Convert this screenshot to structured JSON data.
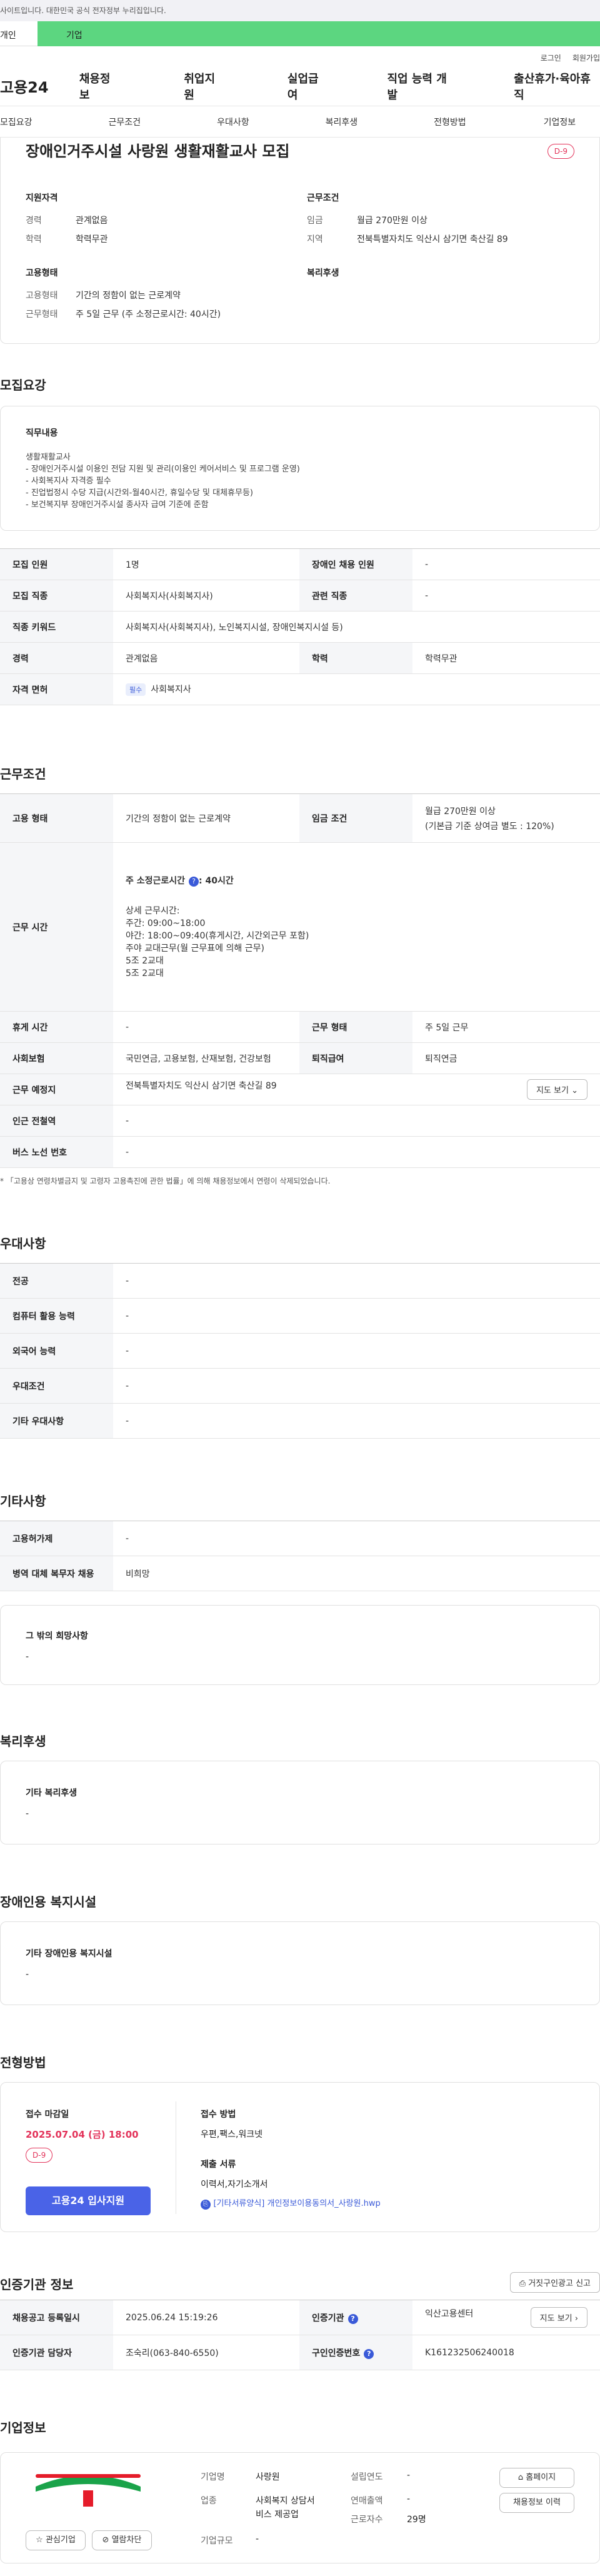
{
  "gov_notice": "사이트입니다. 대한민국 공식 전자정부 누리집입니다.",
  "tabs": {
    "person": "개인",
    "corp": "기업"
  },
  "util": {
    "login": "로그인",
    "join": "회원가입"
  },
  "logo": "고용24",
  "gnb": [
    "채용정보",
    "취업지원",
    "실업급여",
    "직업 능력 개발",
    "출산휴가·육아휴직"
  ],
  "subnav": [
    "모집요강",
    "근무조건",
    "우대사항",
    "복리후생",
    "전형방법",
    "기업정보"
  ],
  "job": {
    "title": "장애인거주시설 사랑원 생활재활교사 모집",
    "dday": "D-9"
  },
  "summary": {
    "qual_head": "지원자격",
    "career_label": "경력",
    "career": "관계없음",
    "edu_label": "학력",
    "edu": "학력무관",
    "cond_head": "근무조건",
    "wage_label": "임금",
    "wage": "월급 270만원 이상",
    "region_label": "지역",
    "region": "전북특별자치도 익산시 삼기면 축산길 89",
    "emp_head": "고용형태",
    "type_label": "고용형태",
    "type": "기간의 정함이 없는 근로계약",
    "shift_label": "근무형태",
    "shift": "주 5일 근무 (주 소정근로시간: 40시간)",
    "welfare_head": "복리후생"
  },
  "recruit": {
    "title": "모집요강",
    "duty_head": "직무내용",
    "duty_lines": [
      "생활재활교사",
      "- 장애인거주시설 이용인 전담 지원 및 관리(이용인 케어서비스 및 프로그램 운영)",
      "- 사회복지사 자격증 필수",
      "- 진업법정시 수당 지급(시간외-월40시간, 휴일수당 및 대체휴무등)",
      "- 보건복지부 장애인거주시설 종사자 급여 기준에 준함"
    ],
    "rows": [
      {
        "l1": "모집 인원",
        "v1": "1명",
        "l2": "장애인 채용 인원",
        "v2": "-"
      },
      {
        "l1": "모집 직종",
        "v1": "사회복지사(사회복지사)",
        "l2": "관련 직종",
        "v2": "-"
      }
    ],
    "keyword_label": "직종 키워드",
    "keyword": "사회복지사(사회복지사), 노인복지시설, 장애인복지시설 등)",
    "career_label": "경력",
    "career": "관계없음",
    "edu_label": "학력",
    "edu": "학력무관",
    "license_label": "자격 면허",
    "license_badge": "필수",
    "license": "사회복지사"
  },
  "work": {
    "title": "근무조건",
    "type_label": "고용 형태",
    "type": "기간의 정함이 없는 근로계약",
    "wage_label": "임금 조건",
    "wage1": "월급 270만원 이상",
    "wage2": "(기본급 기준 상여금 별도 : 120%)",
    "hours_label": "근무 시간",
    "hours_weekly": "주 소정근로시간",
    "hours_weekly_val": ": 40시간",
    "hours_detail_head": "상세 근무시간:",
    "hours_lines": [
      "주간: 09:00~18:00",
      "야간: 18:00~09:40(휴게시간, 시간외근무 포함)",
      "주야 교대근무(월 근무표에 의해 근무)",
      "5조 2교대",
      "5조 2교대"
    ],
    "break_label": "휴게 시간",
    "break": "-",
    "form_label": "근무 형태",
    "form": "주 5일 근무",
    "insurance_label": "사회보험",
    "insurance": "국민연금, 고용보험, 산재보험, 건강보험",
    "retire_label": "퇴직급여",
    "retire": "퇴직연금",
    "place_label": "근무 예정지",
    "place": "전북특별자치도 익산시 삼기면 축산길 89",
    "map_btn": "지도 보기",
    "subway_label": "인근 전철역",
    "subway": "-",
    "bus_label": "버스 노선 번호",
    "bus": "-",
    "note": "* 「고용상 연령차별금지 및 고령자 고용촉진에 관한 법률」에 의해 채용정보에서 연령이 삭제되었습니다."
  },
  "pref": {
    "title": "우대사항",
    "rows": [
      {
        "l": "전공",
        "v": "-"
      },
      {
        "l": "컴퓨터 활용 능력",
        "v": "-"
      },
      {
        "l": "외국어 능력",
        "v": "-"
      },
      {
        "l": "우대조건",
        "v": "-"
      },
      {
        "l": "기타 우대사항",
        "v": "-"
      }
    ]
  },
  "etc": {
    "title": "기타사항",
    "rows": [
      {
        "l": "고용허가제",
        "v": "-"
      },
      {
        "l": "병역 대체 복무자 채용",
        "v": "비희망"
      }
    ],
    "other_head": "그 밖의 희망사항",
    "other": "-"
  },
  "welfare": {
    "title": "복리후생",
    "head": "기타 복리후생",
    "value": "-"
  },
  "disabled": {
    "title": "장애인용 복지시설",
    "head": "기타 장애인용 복지시설",
    "value": "-"
  },
  "process": {
    "title": "전형방법",
    "deadline_head": "접수 마감일",
    "deadline": "2025.07.04 (금) 18:00",
    "dday": "D-9",
    "apply_btn": "고용24 입사지원",
    "method_head": "접수 방법",
    "method": "우편,팩스,워크넷",
    "docs_head": "제출 서류",
    "docs": "이력서,자기소개서",
    "file": "[기타서류양식] 개인정보이용동의서_사랑원.hwp"
  },
  "cert": {
    "title": "인증기관 정보",
    "report_btn": "거짓구인광고 신고",
    "reg_label": "채용공고 등록일시",
    "reg": "2025.06.24 15:19:26",
    "org_label": "인증기관",
    "org": "익산고용센터",
    "map_btn": "지도 보기",
    "manager_label": "인증기관 담당자",
    "manager": "조숙리(063-840-6550)",
    "notice_label": "구인인증번호",
    "notice": "K161232506240018"
  },
  "company": {
    "title": "기업정보",
    "fav_btn": "관심기업",
    "block_btn": "열람차단",
    "name_label": "기업명",
    "name": "사랑원",
    "industry_label": "업종",
    "industry1": "사회복지 상담서",
    "industry2": "비스 제공업",
    "size_label": "기업규모",
    "size": "-",
    "founded_label": "설립연도",
    "founded": "-",
    "sales_label": "연매출액",
    "sales": "-",
    "staff_label": "근로자수",
    "staff": "29명",
    "home_btn": "홈페이지",
    "jobs_btn": "채용정보 이력"
  },
  "colors": {
    "accent": "#4a63e7",
    "dday": "#e3335a",
    "tab": "#5cd680"
  }
}
